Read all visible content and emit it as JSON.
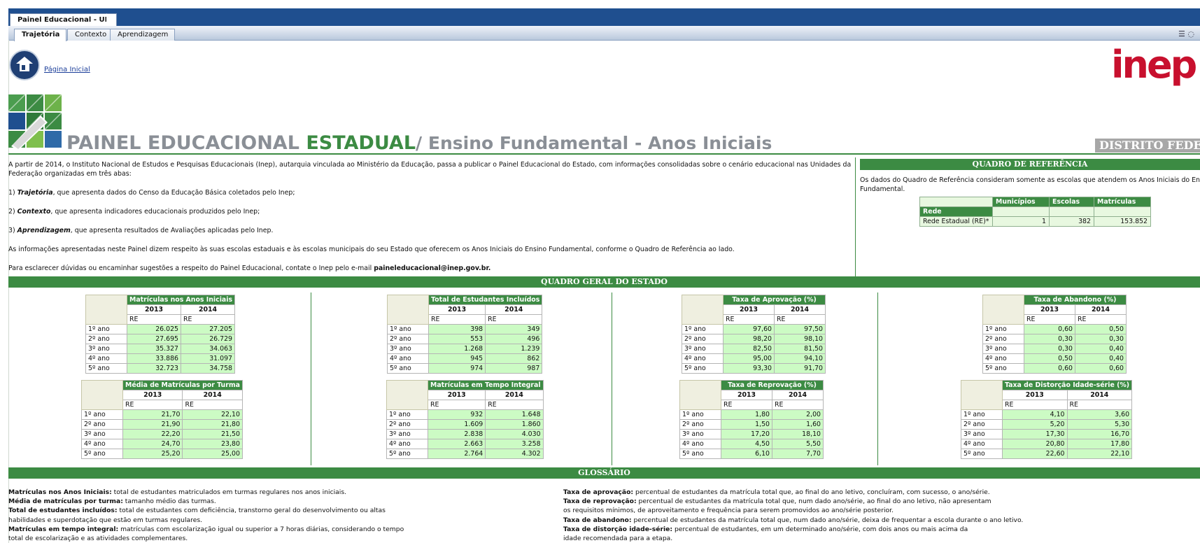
{
  "window": {
    "app_tab": "Painel Educacional - UF",
    "tabs": [
      "Trajetória",
      "Contexto",
      "Aprendizagem"
    ],
    "active_tab": "Trajetória"
  },
  "header": {
    "home_link": "Página Inicial",
    "inep_logo_text": "inep",
    "brand_part1": "PAINEL EDUCACIONAL ",
    "brand_part2": "ESTADUAL",
    "brand_part3": "/ Ensino Fundamental - Anos Iniciais",
    "uf": "DISTRITO FEDERAL"
  },
  "intro": {
    "p1": "A partir de 2014, o Instituto Nacional de Estudos e Pesquisas Educacionais (Inep), autarquia vinculada ao Ministério da Educação, passa a publicar o Painel Educacional do Estado, com informações consolidadas sobre o cenário educacional nas Unidades da Federação organizadas em três abas:",
    "i1_num": "1) ",
    "i1_term": "Trajetória",
    "i1_text": ", que apresenta dados do Censo da Educação Básica coletados pelo Inep;",
    "i2_num": "2) ",
    "i2_term": "Contexto",
    "i2_text": ", que apresenta indicadores educacionais produzidos pelo Inep;",
    "i3_num": "3) ",
    "i3_term": "Aprendizagem",
    "i3_text": ", que apresenta resultados de Avaliações aplicadas pelo Inep.",
    "p2": "As informações apresentadas neste Painel dizem respeito às suas escolas estaduais e às escolas municipais do seu Estado que oferecem os Anos Iniciais do Ensino Fundamental, conforme o Quadro de Referência ao lado.",
    "p3_text": "Para esclarecer dúvidas ou encaminhar sugestões a respeito do Painel Educacional, contate o Inep pelo e-mail ",
    "p3_email": "paineleducacional@inep.gov.br."
  },
  "reference": {
    "title": "QUADRO DE REFERÊNCIA",
    "text_line1": "Os dados do Quadro de Referência consideram somente as escolas que atendem os Anos Iniciais do Ensino",
    "text_line2": "Fundamental.",
    "col_municipios": "Municípios",
    "col_escolas": "Escolas",
    "col_matriculas": "Matrículas",
    "row_header": "Rede",
    "row_label": "Rede Estadual (RE)*",
    "row_municipios": "1",
    "row_escolas": "382",
    "row_matriculas": "153.852"
  },
  "quadro_geral_title": "QUADRO GERAL DO ESTADO",
  "year_a": "2013",
  "year_b": "2014",
  "re_label": "RE",
  "row_labels": [
    "1º ano",
    "2º ano",
    "3º ano",
    "4º ano",
    "5º ano"
  ],
  "tables": {
    "t1": {
      "title": "Matrículas nos Anos Iniciais",
      "a": [
        "26.025",
        "27.695",
        "35.327",
        "33.886",
        "32.723"
      ],
      "b": [
        "27.205",
        "26.729",
        "34.063",
        "31.097",
        "34.758"
      ]
    },
    "t2": {
      "title": "Total de Estudantes Incluídos",
      "a": [
        "398",
        "553",
        "1.268",
        "945",
        "974"
      ],
      "b": [
        "349",
        "496",
        "1.239",
        "862",
        "987"
      ]
    },
    "t3": {
      "title": "Taxa de Aprovação (%)",
      "a": [
        "97,60",
        "98,20",
        "82,50",
        "95,00",
        "93,30"
      ],
      "b": [
        "97,50",
        "98,10",
        "81,50",
        "94,10",
        "91,70"
      ]
    },
    "t4": {
      "title": "Taxa de Abandono (%)",
      "a": [
        "0,60",
        "0,30",
        "0,30",
        "0,50",
        "0,60"
      ],
      "b": [
        "0,50",
        "0,30",
        "0,40",
        "0,40",
        "0,60"
      ]
    },
    "t5": {
      "title": "Média de Matrículas por Turma",
      "a": [
        "21,70",
        "21,90",
        "22,20",
        "24,70",
        "25,20"
      ],
      "b": [
        "22,10",
        "21,80",
        "21,50",
        "23,80",
        "25,00"
      ]
    },
    "t6": {
      "title": "Matrículas em Tempo Integral",
      "a": [
        "932",
        "1.609",
        "2.838",
        "2.663",
        "2.764"
      ],
      "b": [
        "1.648",
        "1.860",
        "4.030",
        "3.258",
        "4.302"
      ]
    },
    "t7": {
      "title": "Taxa de Reprovação (%)",
      "a": [
        "1,80",
        "1,50",
        "17,20",
        "4,50",
        "6,10"
      ],
      "b": [
        "2,00",
        "1,60",
        "18,10",
        "5,50",
        "7,70"
      ]
    },
    "t8": {
      "title": "Taxa de Distorção Idade-série (%)",
      "a": [
        "4,10",
        "5,20",
        "17,30",
        "20,80",
        "22,60"
      ],
      "b": [
        "3,60",
        "5,30",
        "16,70",
        "17,80",
        "22,10"
      ]
    }
  },
  "glossary": {
    "title": "GLOSSÁRIO",
    "l1_term": "Matrículas nos Anos Iniciais:",
    "l1_text": " total de estudantes matriculados em turmas regulares nos anos iniciais.",
    "l2_term": "Média de matrículas por turma:",
    "l2_text": " tamanho médio das turmas.",
    "l3_term": "Total de estudantes incluídos:",
    "l3_text": " total de estudantes com deficiência, transtorno geral do desenvolvimento ou altas",
    "l3_cont": "habilidades e superdotação que estão em turmas regulares.",
    "l4_term": "Matrículas em tempo integral:",
    "l4_text": " matrículas com escolarização igual ou superior a 7 horas diárias, considerando o tempo",
    "l4_cont": "total de escolarização e as atividades complementares.",
    "r1_term": "Taxa de aprovação:",
    "r1_text": " percentual de estudantes da matrícula total que, ao final do ano letivo, concluíram, com sucesso, o ano/série.",
    "r2_term": "Taxa de reprovação:",
    "r2_text": " percentual de estudantes da matrícula total que, num dado ano/série, ao final do ano letivo, não apresentam",
    "r2_cont": "os requisitos mínimos, de aproveitamento e frequência para serem promovidos ao ano/série posterior.",
    "r3_term": "Taxa de abandono:",
    "r3_text": " percentual de estudantes da matrícula total que, num dado ano/série, deixa de frequentar a escola durante o ano letivo.",
    "r4_term": "Taxa de distorção idade-série:",
    "r4_text": " percentual de estudantes, em um determinado ano/série, com dois anos ou mais acima da",
    "r4_cont": "idade recomendada para a etapa."
  },
  "colors": {
    "green": "#3c8b43",
    "navy": "#1f4f8f",
    "value_bg": "#ccfbc4",
    "inep_red": "#c8102e"
  }
}
